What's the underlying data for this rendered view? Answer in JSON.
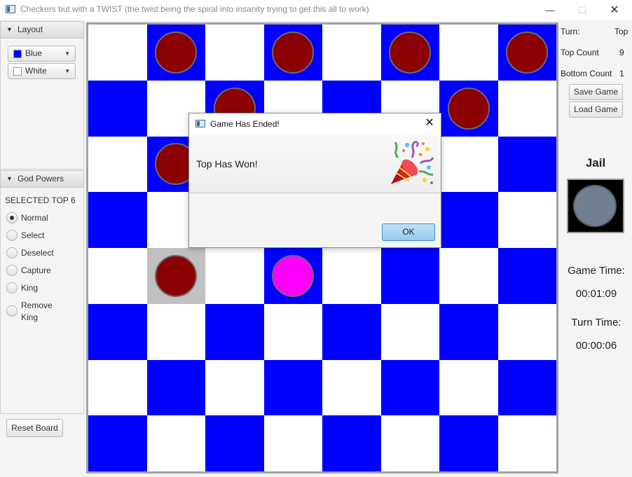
{
  "window": {
    "title": "Checkers but with a TWIST (the twist being the spiral into insanity trying to get this all to work)",
    "minimize_glyph": "—",
    "maximize_glyph": "☐",
    "close_glyph": "✕"
  },
  "left_panel": {
    "layout_header": "Layout",
    "top_color": {
      "label": "Blue",
      "swatch": "#0000ff"
    },
    "bottom_color": {
      "label": "White",
      "swatch": "#ffffff"
    },
    "god_powers_header": "God Powers",
    "selected_label": "SELECTED TOP 6",
    "powers": [
      {
        "label": "Normal",
        "selected": true
      },
      {
        "label": "Select",
        "selected": false
      },
      {
        "label": "Deselect",
        "selected": false
      },
      {
        "label": "Capture",
        "selected": false
      },
      {
        "label": "King",
        "selected": false
      },
      {
        "label": "Remove King",
        "selected": false
      }
    ],
    "reset_label": "Reset Board"
  },
  "board": {
    "rows": 8,
    "cols": 8,
    "colors": {
      "light": "#ffffff",
      "dark": "#0000ff",
      "highlight": "#c0c0c0",
      "red_piece": "#8b0000",
      "selected_piece": "#ff00ff"
    },
    "highlight_squares": [
      [
        4,
        1
      ]
    ],
    "pieces": [
      {
        "row": 0,
        "col": 1,
        "color": "#8b0000"
      },
      {
        "row": 0,
        "col": 3,
        "color": "#8b0000"
      },
      {
        "row": 0,
        "col": 5,
        "color": "#8b0000"
      },
      {
        "row": 0,
        "col": 7,
        "color": "#8b0000"
      },
      {
        "row": 1,
        "col": 2,
        "color": "#8b0000"
      },
      {
        "row": 1,
        "col": 6,
        "color": "#8b0000"
      },
      {
        "row": 2,
        "col": 1,
        "color": "#8b0000"
      },
      {
        "row": 4,
        "col": 1,
        "color": "#8b0000"
      },
      {
        "row": 4,
        "col": 3,
        "color": "#ff00ff"
      }
    ]
  },
  "right_panel": {
    "turn_label": "Turn:",
    "turn_value": "Top",
    "top_count_label": "Top Count",
    "top_count_value": "9",
    "bottom_count_label": "Bottom Count",
    "bottom_count_value": "1",
    "save_label": "Save Game",
    "load_label": "Load Game",
    "jail_title": "Jail",
    "jail_piece_color": "#708090",
    "game_time_label": "Game Time:",
    "game_time_value": "00:01:09",
    "turn_time_label": "Turn Time:",
    "turn_time_value": "00:00:06"
  },
  "dialog": {
    "title": "Game Has Ended!",
    "message": "Top Has Won!",
    "ok_label": "OK",
    "icon": "party-popper-icon"
  }
}
